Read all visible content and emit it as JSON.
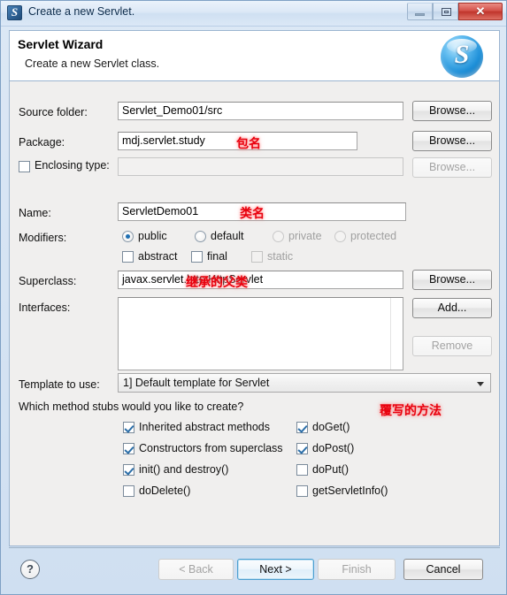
{
  "window": {
    "title": "Create a new Servlet.",
    "icon": "servlet-icon",
    "controls": {
      "minimize": "minimize-icon",
      "maximize": "restore-icon",
      "close": "✕"
    }
  },
  "header": {
    "title": "Servlet Wizard",
    "subtitle": "Create a new Servlet class.",
    "logo_letter": "S"
  },
  "form": {
    "source_folder": {
      "label": "Source folder:",
      "value": "Servlet_Demo01/src",
      "browse": "Browse..."
    },
    "package": {
      "label": "Package:",
      "value": "mdj.servlet.study",
      "browse": "Browse...",
      "annotation": "包名"
    },
    "enclosing_type": {
      "label": "Enclosing type:",
      "value": "",
      "checked": false,
      "browse": "Browse...",
      "disabled": true
    },
    "name": {
      "label": "Name:",
      "value": "ServletDemo01",
      "annotation": "类名"
    },
    "modifiers": {
      "label": "Modifiers:",
      "radios": [
        {
          "label": "public",
          "selected": true,
          "disabled": false
        },
        {
          "label": "default",
          "selected": false,
          "disabled": false
        },
        {
          "label": "private",
          "selected": false,
          "disabled": true
        },
        {
          "label": "protected",
          "selected": false,
          "disabled": true
        }
      ],
      "checks": [
        {
          "label": "abstract",
          "checked": false,
          "disabled": false
        },
        {
          "label": "final",
          "checked": false,
          "disabled": false
        },
        {
          "label": "static",
          "checked": false,
          "disabled": true
        }
      ]
    },
    "superclass": {
      "label": "Superclass:",
      "value": "javax.servlet.http.HttpServlet",
      "browse": "Browse...",
      "annotation": "继承的父类"
    },
    "interfaces": {
      "label": "Interfaces:",
      "items": [],
      "add": "Add...",
      "remove": "Remove",
      "remove_disabled": true
    },
    "template": {
      "label": "Template to use:",
      "selected": "1] Default template for Servlet"
    },
    "stubs": {
      "question": "Which method stubs would you like to create?",
      "annotation": "覆写的方法",
      "left_column": [
        {
          "label": "Inherited abstract methods",
          "checked": true
        },
        {
          "label": "Constructors from superclass",
          "checked": true
        },
        {
          "label": "init() and destroy()",
          "checked": true
        },
        {
          "label": "doDelete()",
          "checked": false
        }
      ],
      "right_column": [
        {
          "label": "doGet()",
          "checked": true
        },
        {
          "label": "doPost()",
          "checked": true
        },
        {
          "label": "doPut()",
          "checked": false
        },
        {
          "label": "getServletInfo()",
          "checked": false
        }
      ]
    }
  },
  "footer": {
    "help": "?",
    "back": {
      "label": "< Back",
      "disabled": true
    },
    "next": {
      "label": "Next >",
      "disabled": false,
      "default": true
    },
    "finish": {
      "label": "Finish",
      "disabled": true
    },
    "cancel": {
      "label": "Cancel",
      "disabled": false
    }
  },
  "colors": {
    "annotation_red": "#e8000d",
    "accent_blue": "#1f6fb2",
    "close_red": "#c0352c"
  }
}
